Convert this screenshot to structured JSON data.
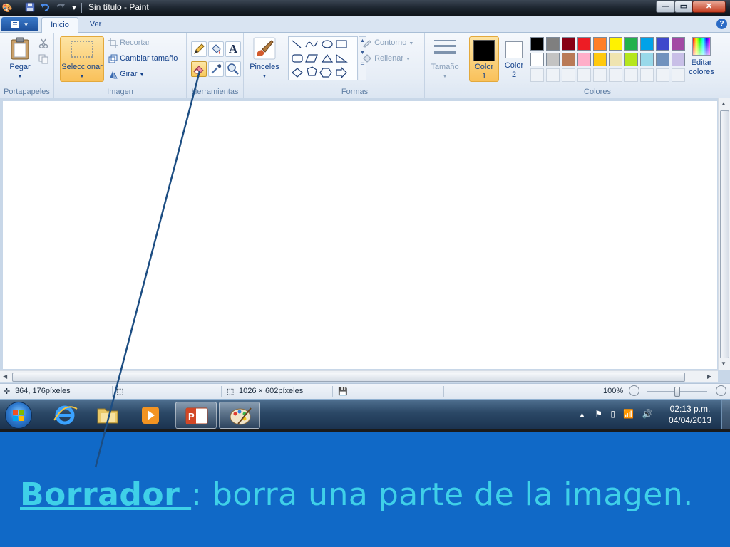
{
  "window": {
    "title": "Sin título - Paint",
    "controls": {
      "minimize": "—",
      "maximize": "▭",
      "close": "✕"
    }
  },
  "tabs": [
    {
      "label": "Inicio",
      "active": true
    },
    {
      "label": "Ver",
      "active": false
    }
  ],
  "ribbon": {
    "portapapeles": {
      "label": "Portapapeles",
      "paste": "Pegar"
    },
    "imagen": {
      "label": "Imagen",
      "select": "Seleccionar",
      "crop": "Recortar",
      "resize": "Cambiar tamaño",
      "rotate": "Girar"
    },
    "herramientas": {
      "label": "Herramientas",
      "text_glyph": "A"
    },
    "pinceles": {
      "label": "Pinceles"
    },
    "formas": {
      "label": "Formas",
      "outline": "Contorno",
      "fill": "Rellenar"
    },
    "tamano": {
      "label": "Tamaño"
    },
    "colores": {
      "label": "Colores",
      "color1": "Color 1",
      "color2": "Color 2",
      "edit": "Editar colores",
      "color1_value": "#000000",
      "color2_value": "#ffffff",
      "palette_row1": [
        "#000000",
        "#7f7f7f",
        "#880015",
        "#ed1c24",
        "#ff7f27",
        "#fff200",
        "#22b14c",
        "#00a2e8",
        "#3f48cc",
        "#a349a4"
      ],
      "palette_row2": [
        "#ffffff",
        "#c3c3c3",
        "#b97a57",
        "#ffaec9",
        "#ffc90e",
        "#efe4b0",
        "#b5e61d",
        "#99d9ea",
        "#7092be",
        "#c8bfe7"
      ]
    }
  },
  "statusbar": {
    "cursor_pos": "364, 176píxeles",
    "image_size": "1026 × 602píxeles",
    "zoom": "100%"
  },
  "taskbar": {
    "time": "02:13 p.m.",
    "date": "04/04/2013"
  },
  "caption": {
    "term": "Borrador ",
    "separator": " : ",
    "definition": "borra una parte de la imagen."
  }
}
